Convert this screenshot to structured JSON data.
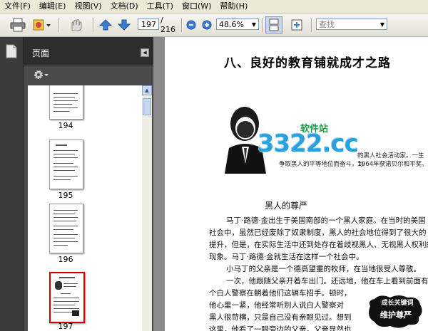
{
  "menu": [
    "文件(F)",
    "编辑(E)",
    "视图(V)",
    "文档(D)",
    "工具(T)",
    "窗口(W)",
    "帮助(H)"
  ],
  "toolbar": {
    "page_current": "197",
    "page_total": "/ 216",
    "zoom": "48.6%",
    "search_placeholder": "查找"
  },
  "nav": {
    "title": "页面",
    "pages": [
      "194",
      "195",
      "196",
      "197"
    ],
    "selected_page": "197"
  },
  "document": {
    "title": "八、良好的教育铺就成才之路",
    "caption_line1": "的黑人社会活动家。一生为",
    "caption_line2": "争取黑人的平等地位而奋斗，1964年获诺贝尔和平奖。",
    "watermark_top": "软件站",
    "watermark_main": "3322.cc",
    "section_heading": "黑人的尊严",
    "paragraphs": [
      "马丁·路德·金出生于美国南部的一个黑人家庭。在当时的美国",
      "社会中，虽然已经废除了奴隶制度，黑人的社会地位得到了很大的",
      "提升，但是，在实际生活中还到处存在着歧视黑人、无视黑人权利的",
      "现象。马丁·路德·金就生活在这样一个社会中。",
      "小马丁的父亲是一个德高望重的牧师，在当地很受人尊敬。",
      "一次，他跟随父亲开着车出门。还远地，他在车上看到前面有一",
      "个白人警察在朝着他们这辆车招手。顿时，",
      "他心里一紧，他经常听别人说白人警察对",
      "黑人很苛横，只是自己没有亲眼见过。想到",
      "这里，他看了一眼旁边的父亲。父亲显然也"
    ],
    "stamp_top": "成长关键词",
    "stamp_bottom": "维护尊严"
  },
  "colors": {
    "selection": "#d20000",
    "panel_dark": "#2d2d2d",
    "toolbar_blue": "#2e6fc5"
  }
}
